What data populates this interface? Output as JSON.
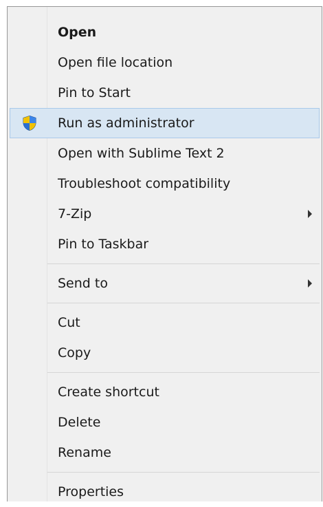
{
  "menu": {
    "items": [
      {
        "label": "Open"
      },
      {
        "label": "Open file location"
      },
      {
        "label": "Pin to Start"
      },
      {
        "label": "Run as administrator",
        "icon": "uac-shield-icon"
      },
      {
        "label": "Open with Sublime Text 2"
      },
      {
        "label": "Troubleshoot compatibility"
      },
      {
        "label": "7-Zip",
        "submenu": true
      },
      {
        "label": "Pin to Taskbar"
      },
      {
        "label": "Send to",
        "submenu": true
      },
      {
        "label": "Cut"
      },
      {
        "label": "Copy"
      },
      {
        "label": "Create shortcut"
      },
      {
        "label": "Delete"
      },
      {
        "label": "Rename"
      },
      {
        "label": "Properties"
      }
    ],
    "highlighted_item": "Run as administrator",
    "colors": {
      "background": "#f0f0f0",
      "highlight_fill": "#d8e6f3",
      "highlight_border": "#a9c9ea",
      "text": "#1a1a1a",
      "shield_blue": "#2a6fd1",
      "shield_yellow": "#f2c200"
    }
  }
}
